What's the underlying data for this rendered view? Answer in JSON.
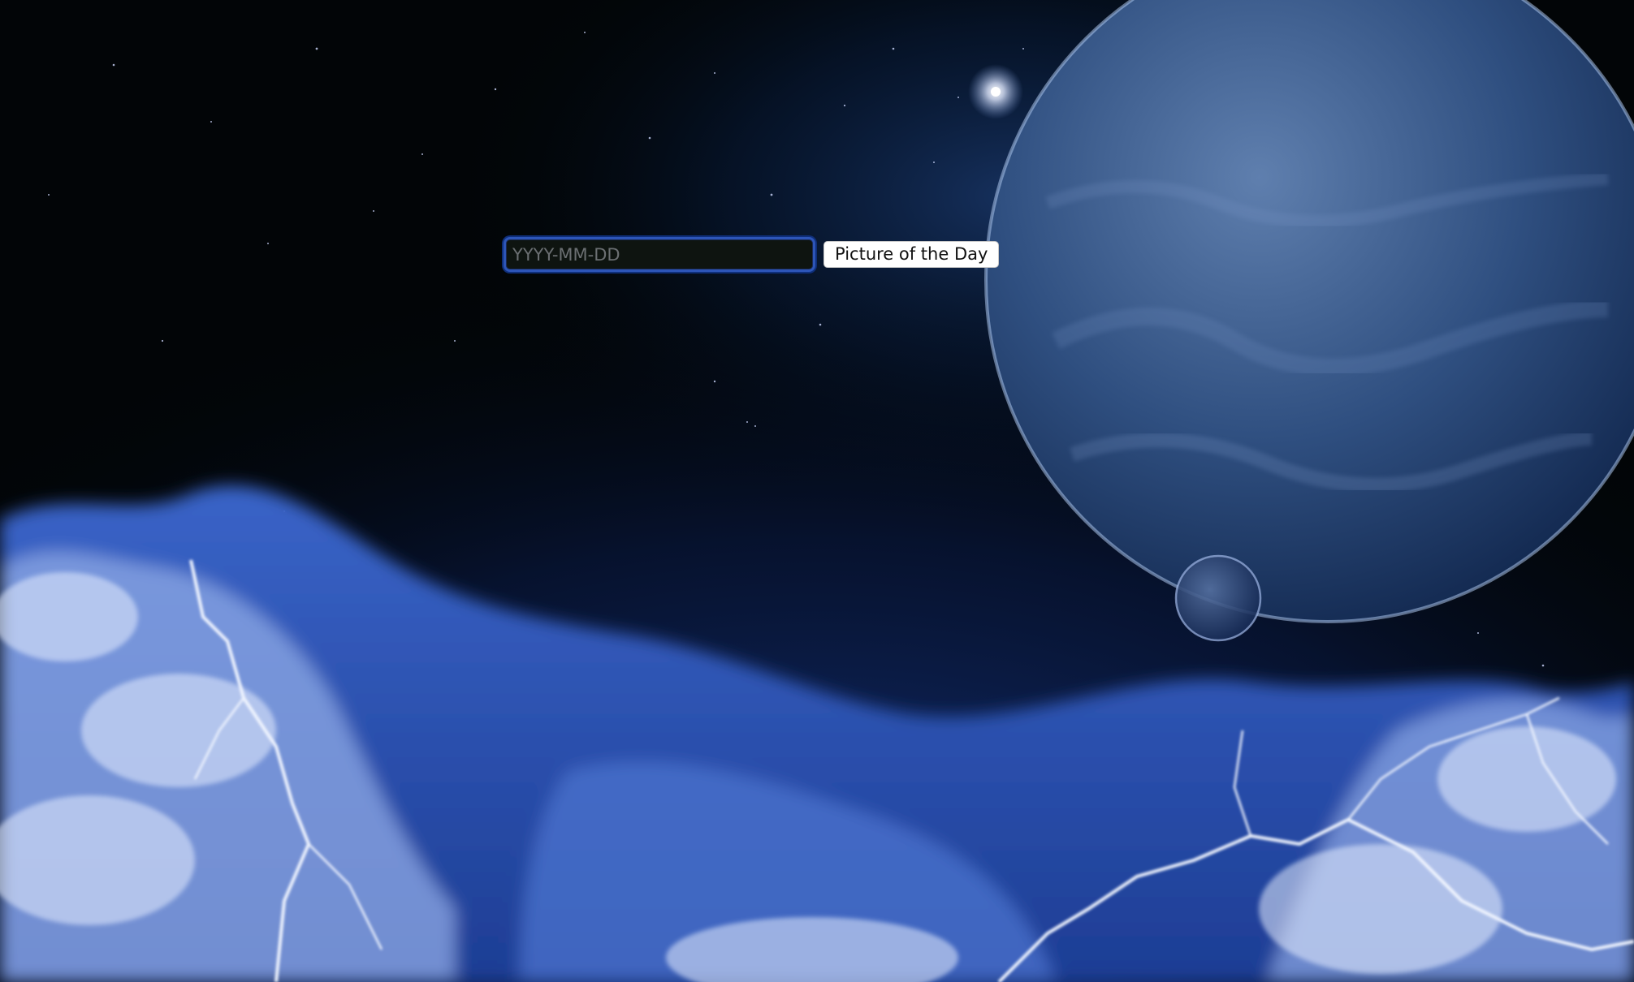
{
  "date_form": {
    "date_placeholder": "YYYY-MM-DD",
    "date_value": "",
    "submit_label": "Picture of the Day"
  },
  "background": {
    "scene": "space wallpaper",
    "colors": {
      "sky": "#020507",
      "nebula": "#0c2a5e",
      "planet": "#2b4a7a",
      "clouds": "#2a58c9",
      "lightning": "#e8f0ff"
    }
  },
  "colors": {
    "input_border": "#2d55b8",
    "input_background": "#0e1410",
    "placeholder": "#6b6f72",
    "button_background": "#ffffff",
    "button_text": "#111111"
  }
}
